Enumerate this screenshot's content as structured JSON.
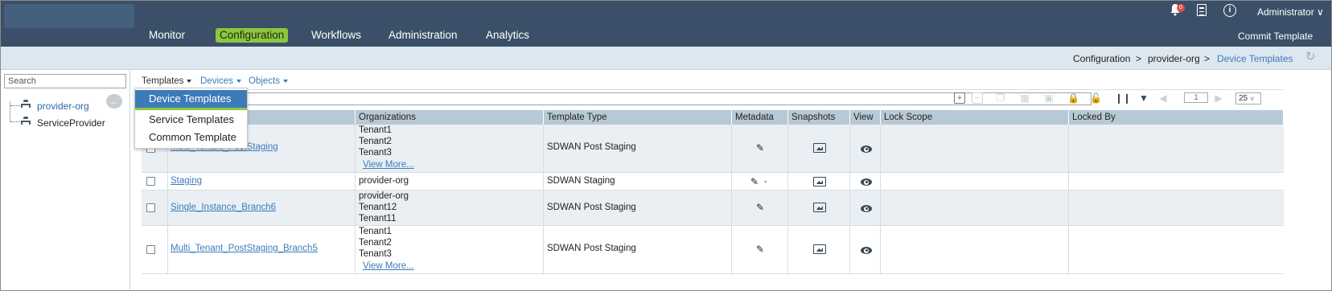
{
  "nav": {
    "items": [
      "Monitor",
      "Configuration",
      "Workflows",
      "Administration",
      "Analytics"
    ],
    "active": "Configuration"
  },
  "header": {
    "notification_count": "0",
    "user": "Administrator",
    "commit_label": "Commit Template",
    "info_glyph": "i"
  },
  "breadcrumb": {
    "items": [
      "Configuration",
      "provider-org",
      "Device Templates"
    ],
    "separator": ">"
  },
  "left_panel": {
    "search_placeholder": "Search",
    "tree": [
      {
        "label": "provider-org",
        "selected": true
      },
      {
        "label": "ServiceProvider",
        "selected": false
      }
    ],
    "collapse_glyph": "←"
  },
  "tabs": {
    "items": [
      "Templates",
      "Devices",
      "Objects"
    ],
    "active": "Templates"
  },
  "templates_menu": {
    "items": [
      "Device Templates",
      "Service Templates",
      "Common Template"
    ],
    "selected": "Device Templates"
  },
  "toolbar": {
    "page_number": "1",
    "page_size": "25"
  },
  "table": {
    "columns": [
      "",
      "",
      "Organizations",
      "Template Type",
      "Metadata",
      "Snapshots",
      "View",
      "Lock Scope",
      "Locked By"
    ],
    "rows": [
      {
        "name": "Multi_Tenant_PostStaging",
        "organizations": [
          "Tenant1",
          "Tenant2",
          "Tenant3"
        ],
        "view_more": "View More...",
        "template_type": "SDWAN Post Staging",
        "metadata_dash": ""
      },
      {
        "name": "Staging",
        "organizations": [
          "provider-org"
        ],
        "view_more": "",
        "template_type": "SDWAN Staging",
        "metadata_dash": "-"
      },
      {
        "name": "Single_Instance_Branch6",
        "organizations": [
          "provider-org",
          "Tenant12",
          "Tenant11"
        ],
        "view_more": "",
        "template_type": "SDWAN Post Staging",
        "metadata_dash": ""
      },
      {
        "name": "Multi_Tenant_PostStaging_Branch5",
        "organizations": [
          "Tenant1",
          "Tenant2",
          "Tenant3"
        ],
        "view_more": "View More...",
        "template_type": "SDWAN Post Staging",
        "metadata_dash": ""
      }
    ]
  },
  "colors": {
    "topbar": "#3b5068",
    "accent_green": "#8cc63f",
    "link_blue": "#3d7bb8",
    "table_header": "#b7c9d6"
  }
}
